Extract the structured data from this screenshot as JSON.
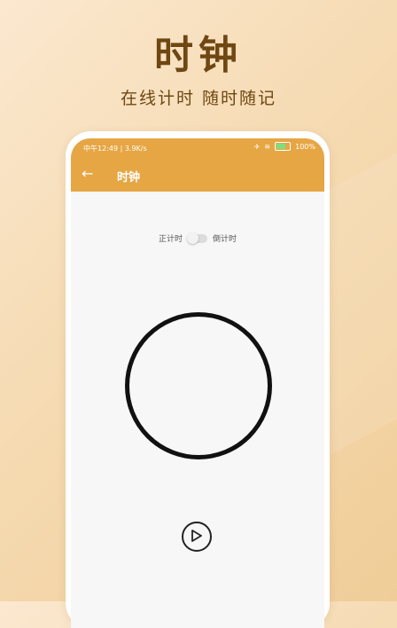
{
  "promo": {
    "title": "时钟",
    "subtitle": "在线计时 随时随记"
  },
  "status_bar": {
    "left_text": "中午12:49 | 3.9K/s",
    "battery": "100%",
    "icons": [
      "airplane-icon",
      "wifi-icon",
      "battery-icon"
    ]
  },
  "app_bar": {
    "back_icon": "←",
    "title": "时钟"
  },
  "timer_mode": {
    "left_label": "正计时",
    "right_label": "倒计时",
    "toggle_on": false
  },
  "controls": {
    "play_icon": "play-icon"
  },
  "colors": {
    "accent": "#e6a644",
    "title": "#6e4712",
    "ring": "#111111"
  }
}
